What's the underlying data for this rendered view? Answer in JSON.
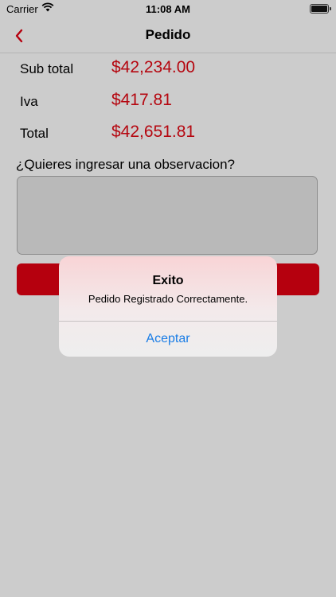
{
  "status_bar": {
    "carrier": "Carrier",
    "time": "11:08 AM"
  },
  "nav": {
    "title": "Pedido"
  },
  "totals": [
    {
      "label": "Sub total",
      "value": "$42,234.00"
    },
    {
      "label": "Iva",
      "value": "$417.81"
    },
    {
      "label": "Total",
      "value": "$42,651.81"
    }
  ],
  "observation": {
    "prompt": "¿Quieres ingresar una observacion?",
    "value": ""
  },
  "alert": {
    "title": "Exito",
    "message": "Pedido Registrado Correctamente.",
    "button": "Aceptar"
  },
  "colors": {
    "accent": "#b5000e",
    "link": "#1a7de6",
    "background": "#cccccc"
  }
}
